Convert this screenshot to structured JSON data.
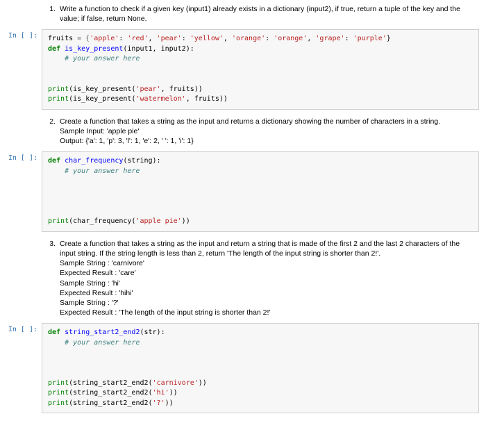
{
  "prompt_label": "In [ ]:",
  "problems": {
    "p1": {
      "num": "1.",
      "text": "Write a function to check if a given key (input1) already exists in a dictionary (input2), if true, return a tuple of the key and the value; if false, return None."
    },
    "p2": {
      "num": "2.",
      "text": "Create a function that takes a string as the input and returns a dictionary showing the number of characters in a string.",
      "sample_in_label": "Sample Input: 'apple pie'",
      "sample_out_label": "Output: {'a': 1, 'p': 3, 'l': 1, 'e': 2, ' ': 1, 'i': 1}"
    },
    "p3": {
      "num": "3.",
      "text": "Create a function that takes a string as the input and return a string that is made of the first 2 and the last 2 characters of the input string. If the string length is less than 2, return 'The length of the input string is shorter than 2!'.",
      "s1a": "Sample String : 'carnivore'",
      "s1b": "Expected Result : 'care'",
      "s2a": "Sample String : 'hi'",
      "s2b": "Expected Result : 'hihi'",
      "s3a": "Sample String : '?'",
      "s3b": "Expected Result : 'The length of the input string is shorter than 2!'"
    }
  },
  "code": {
    "c1": {
      "l1_var": "fruits",
      "l1_eq": " = {",
      "l1_k1": "'apple'",
      "l1_v1": "'red'",
      "l1_k2": "'pear'",
      "l1_v2": "'yellow'",
      "l1_k3": "'orange'",
      "l1_v3": "'orange'",
      "l1_k4": "'grape'",
      "l1_v4": "'purple'",
      "l2_def": "def ",
      "l2_fn": "is_key_present",
      "l2_args": "(input1, input2):",
      "l3_comment": "    # your answer here",
      "blank": "",
      "l5_print": "print",
      "l5_arg1": "'pear'",
      "l5_arg2": "fruits",
      "l6_arg1": "'watermelon'"
    },
    "c2": {
      "l1_def": "def ",
      "l1_fn": "char_frequency",
      "l1_args": "(string):",
      "l2_comment": "    # your answer here",
      "blank": "",
      "l_print": "print",
      "l_arg": "'apple pie'"
    },
    "c3": {
      "l1_def": "def ",
      "l1_fn": "string_start2_end2",
      "l1_args": "(str):",
      "l2_comment": "    # your answer here",
      "blank": "",
      "l_print": "print",
      "a1": "'carnivore'",
      "a2": "'hi'",
      "a3": "'?'"
    }
  }
}
